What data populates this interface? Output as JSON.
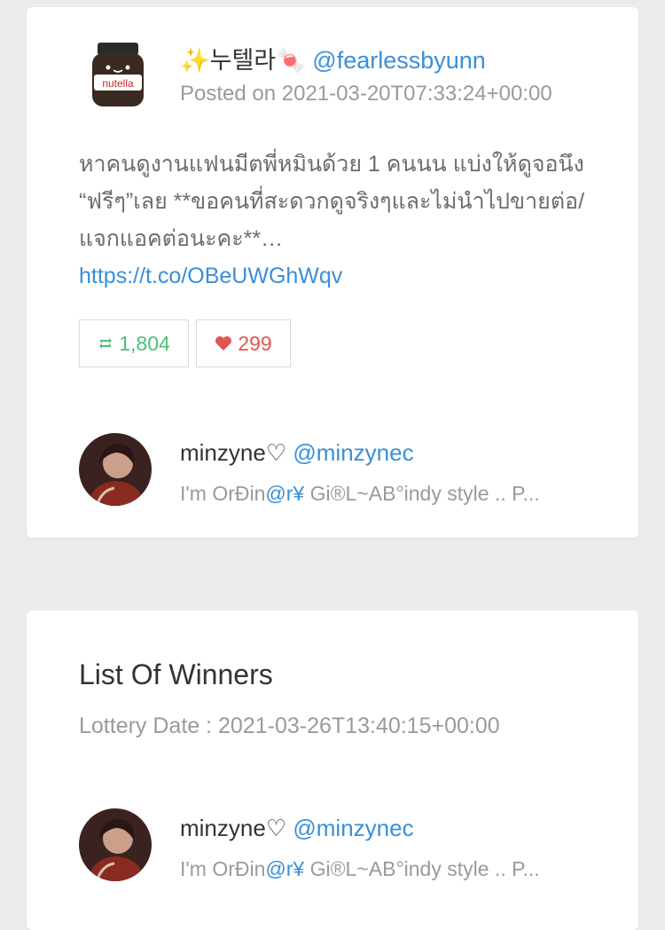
{
  "tweet": {
    "poster_name": "✨누텔라🍬",
    "poster_handle": "@fearlessbyunn",
    "posted_date": "Posted on 2021-03-20T07:33:24+00:00",
    "text": "หาคนดูงานแฟนมีตพี่หมินด้วย 1 คนนน แบ่งให้ดูจอนึง “ฟรีๆ”เลย **ขอคนที่สะดวกดูจริงๆและไม่นำไปขาย​ต่อ/แจกแอคต่อนะคะ**…",
    "link": "https://t.co/OBeUWGhWqv",
    "retweets": "1,804",
    "likes": "299"
  },
  "participant": {
    "name": "minzyne♡",
    "handle": "@minzynec",
    "bio_prefix": "I'm OrĐin",
    "bio_highlight": "@r¥",
    "bio_suffix": " Gi®L~AB°indy style .. P..."
  },
  "winners": {
    "title": "List Of Winners",
    "lottery_date": "Lottery Date : 2021-03-26T13:40:15+00:00",
    "list": [
      {
        "name": "minzyne♡",
        "handle": "@minzynec",
        "bio_prefix": "I'm OrĐin",
        "bio_highlight": "@r¥",
        "bio_suffix": " Gi®L~AB°indy style .. P..."
      }
    ]
  },
  "colors": {
    "link": "#3a8fd8",
    "retweet": "#4cc07a",
    "like": "#e0574f",
    "muted": "#9a9a9a"
  },
  "icons": {
    "retweet": "retweet-icon",
    "like": "heart-icon"
  }
}
